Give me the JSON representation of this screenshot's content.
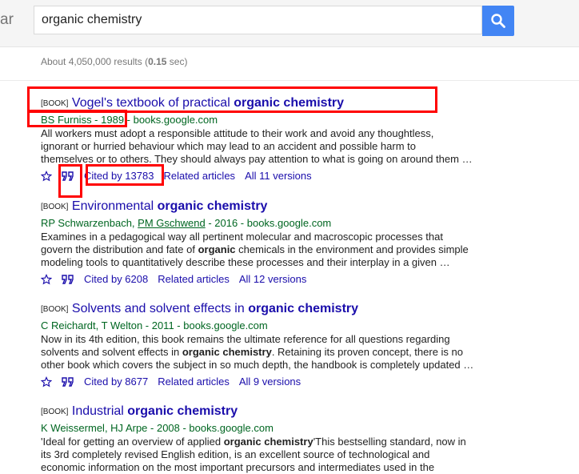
{
  "header": {
    "logo_fragment": "ar",
    "search_value": "organic chemistry",
    "search_button": "search-icon"
  },
  "stats": {
    "prefix": "About 4,050,000 results (",
    "time": "0.15",
    "suffix": " sec)"
  },
  "results": [
    {
      "tag": "[BOOK]",
      "title_plain": "Vogel's textbook of practical ",
      "title_bold": "organic chemistry",
      "authors": "BS Furniss - 1989 - books.google.com",
      "snippet_lines": [
        "All workers must adopt a responsible attitude to their work and avoid any thoughtless,",
        "ignorant or hurried behaviour which may lead to an accident and possible harm to",
        "themselves or to others. They should always pay attention to what is going on around them …"
      ],
      "cited_by": "Cited by 13783",
      "related": "Related articles",
      "versions": "All 11 versions"
    },
    {
      "tag": "[BOOK]",
      "title_plain": "Environmental ",
      "title_bold": "organic chemistry",
      "authors_a": "RP Schwarzenbach, ",
      "authors_b": "PM Gschwend",
      "authors_c": " - 2016 - books.google.com",
      "snippet1_a": "Examines in a pedagogical way all pertinent molecular and macroscopic processes that",
      "snippet2_a": "govern the distribution and fate of ",
      "snippet2_b": "organic",
      "snippet2_c": " chemicals in the environment and provides simple",
      "snippet3_a": "modeling tools to quantitatively describe these processes and their interplay in a given …",
      "cited_by": "Cited by 6208",
      "related": "Related articles",
      "versions": "All 12 versions"
    },
    {
      "tag": "[BOOK]",
      "title_plain": "Solvents and solvent effects in ",
      "title_bold": "organic chemistry",
      "authors": "C Reichardt, T Welton - 2011 - books.google.com",
      "snippet1_a": "Now in its 4th edition, this book remains the ultimate reference for all questions regarding",
      "snippet2_a": "solvents and solvent effects in ",
      "snippet2_b": "organic chemistry",
      "snippet2_c": ". Retaining its proven concept, there is no",
      "snippet3_a": "other book which covers the subject in so much depth, the handbook is completely updated …",
      "cited_by": "Cited by 8677",
      "related": "Related articles",
      "versions": "All 9 versions"
    },
    {
      "tag": "[BOOK]",
      "title_plain": "Industrial ",
      "title_bold": "organic chemistry",
      "authors": "K Weissermel, HJ Arpe - 2008 - books.google.com",
      "snippet1_a": "'Ideal for getting an overview of applied ",
      "snippet1_b": "organic chemistry",
      "snippet1_c": "'This bestselling standard, now in",
      "snippet2_a": "its 3rd completely revised English edition, is an excellent source of technological and",
      "snippet3_a": "economic information on the most important precursors and intermediates used in the"
    }
  ],
  "colors": {
    "link": "#1a0dab",
    "author": "#006621",
    "highlight": "#ff0000",
    "accent": "#4285f4"
  }
}
